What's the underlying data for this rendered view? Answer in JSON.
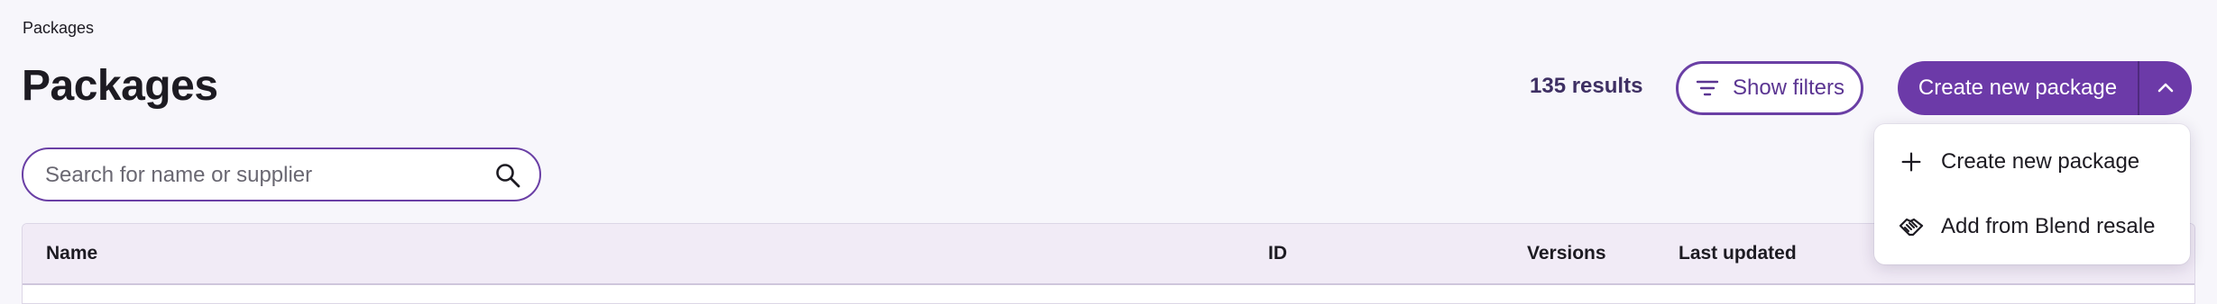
{
  "breadcrumb": "Packages",
  "page_title": "Packages",
  "results": "135 results",
  "filters_button": {
    "label": "Show filters",
    "icon": "filter-icon"
  },
  "create_button": {
    "label": "Create new package",
    "toggle_icon": "chevron-up-icon"
  },
  "search": {
    "placeholder": "Search for name or supplier",
    "value": "",
    "icon": "search-icon"
  },
  "table": {
    "columns": [
      "Name",
      "ID",
      "Versions",
      "Last updated"
    ]
  },
  "dropdown": {
    "items": [
      {
        "label": "Create new package",
        "icon": "plus-icon"
      },
      {
        "label": "Add from Blend resale",
        "icon": "handshake-icon"
      }
    ]
  },
  "colors": {
    "accent": "#6c3aa8",
    "background": "#f7f6fb",
    "header_row": "#f1ebf6"
  }
}
